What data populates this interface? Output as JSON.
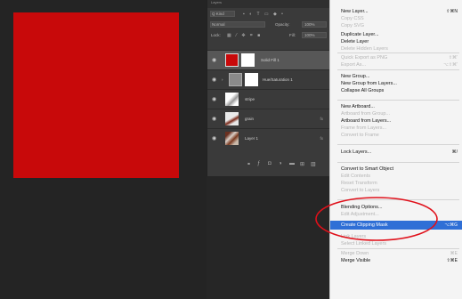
{
  "colors": {
    "artwork_red": "#c8090a",
    "menu_highlight": "#2f6fd6",
    "annotation": "#e0101a"
  },
  "layers_panel": {
    "tab_label": "Layers",
    "filter_kind": "Q Kind",
    "blend_mode": "Normal",
    "opacity_label": "Opacity:",
    "opacity_value": "100%",
    "lock_label": "Lock:",
    "fill_label": "Fill:",
    "fill_value": "100%",
    "layers": [
      {
        "name": "Solid Fill 1",
        "fx": ""
      },
      {
        "name": "Hue/Saturation 1",
        "fx": ""
      },
      {
        "name": "stripe",
        "fx": ""
      },
      {
        "name": "grain",
        "fx": "fx"
      },
      {
        "name": "Layer 1",
        "fx": "fx"
      }
    ]
  },
  "context_menu": {
    "items": [
      {
        "label": "New Layer...",
        "shortcut": "⇧⌘N",
        "state": "enabled"
      },
      {
        "label": "Copy CSS",
        "shortcut": "",
        "state": "disabled"
      },
      {
        "label": "Copy SVG",
        "shortcut": "",
        "state": "disabled"
      },
      {
        "label": "Duplicate Layer...",
        "shortcut": "",
        "state": "enabled"
      },
      {
        "label": "Delete Layer",
        "shortcut": "",
        "state": "enabled"
      },
      {
        "label": "Delete Hidden Layers",
        "shortcut": "",
        "state": "disabled"
      },
      {
        "label": "Quick Export as PNG",
        "shortcut": "⇧⌘'",
        "state": "disabled"
      },
      {
        "label": "Export As...",
        "shortcut": "⌥⇧⌘'",
        "state": "disabled"
      },
      {
        "label": "New Group...",
        "shortcut": "",
        "state": "enabled"
      },
      {
        "label": "New Group from Layers...",
        "shortcut": "",
        "state": "enabled"
      },
      {
        "label": "Collapse All Groups",
        "shortcut": "",
        "state": "enabled"
      },
      {
        "label": "New Artboard...",
        "shortcut": "",
        "state": "enabled"
      },
      {
        "label": "Artboard from Group...",
        "shortcut": "",
        "state": "disabled"
      },
      {
        "label": "Artboard from Layers...",
        "shortcut": "",
        "state": "enabled"
      },
      {
        "label": "Frame from Layers...",
        "shortcut": "",
        "state": "disabled"
      },
      {
        "label": "Convert to Frame",
        "shortcut": "",
        "state": "disabled"
      },
      {
        "label": "Lock Layers...",
        "shortcut": "⌘/",
        "state": "enabled"
      },
      {
        "label": "Convert to Smart Object",
        "shortcut": "",
        "state": "enabled"
      },
      {
        "label": "Edit Contents",
        "shortcut": "",
        "state": "disabled"
      },
      {
        "label": "Reset Transform",
        "shortcut": "",
        "state": "disabled"
      },
      {
        "label": "Convert to Layers",
        "shortcut": "",
        "state": "disabled"
      },
      {
        "label": "Blending Options...",
        "shortcut": "",
        "state": "enabled"
      },
      {
        "label": "Edit Adjustment...",
        "shortcut": "",
        "state": "disabled"
      },
      {
        "label": "Create Clipping Mask",
        "shortcut": "⌥⌘G",
        "state": "highlight"
      },
      {
        "label": "Link Layers",
        "shortcut": "",
        "state": "disabled"
      },
      {
        "label": "Select Linked Layers",
        "shortcut": "",
        "state": "disabled"
      },
      {
        "label": "Merge Down",
        "shortcut": "⌘E",
        "state": "disabled"
      },
      {
        "label": "Merge Visible",
        "shortcut": "⇧⌘E",
        "state": "enabled"
      }
    ]
  }
}
